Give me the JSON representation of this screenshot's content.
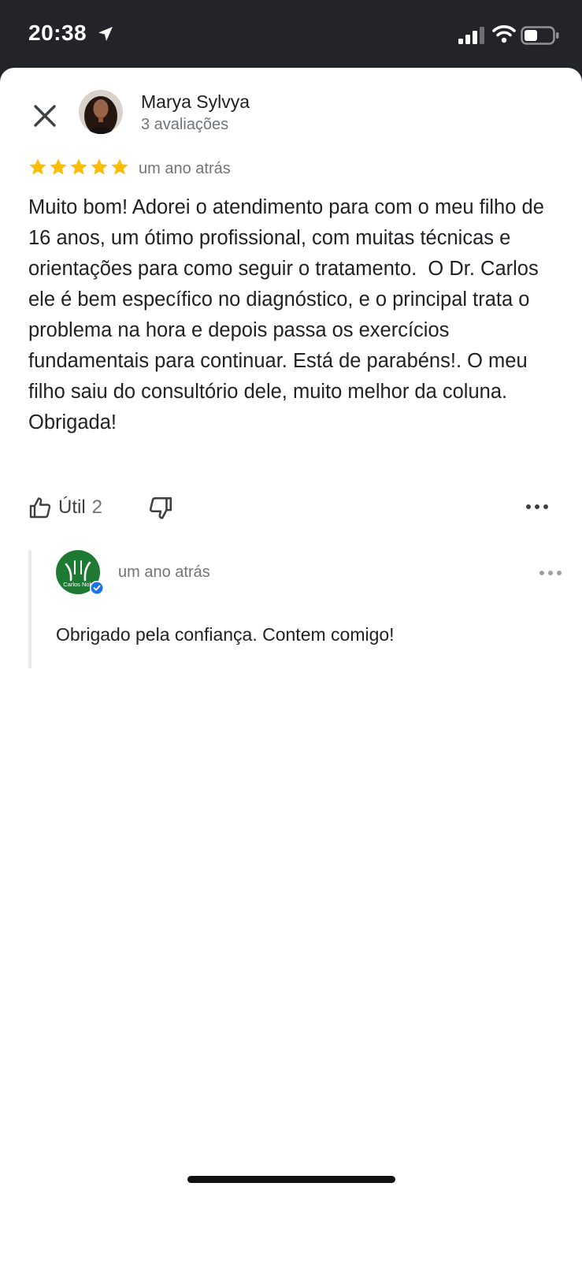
{
  "status_bar": {
    "time": "20:38",
    "icons": [
      "location-arrow-icon",
      "cellular-signal-icon",
      "wifi-icon",
      "battery-icon"
    ]
  },
  "review": {
    "reviewer_name": "Marya Sylvya",
    "reviewer_reviews": "3 avaliações",
    "rating": 5,
    "date": "um ano atrás",
    "text": "Muito bom! Adorei o atendimento para com o meu filho de 16 anos, um ótimo profissional, com muitas técnicas e orientações para como seguir o tratamento.  O Dr. Carlos ele é bem específico no diagnóstico, e o principal trata o problema na hora e depois passa os exercícios fundamentais para continuar. Está de parabéns!. O meu filho saiu do consultório dele, muito melhor da coluna. Obrigada!",
    "helpful_label": "Útil",
    "helpful_count": "2"
  },
  "owner_reply": {
    "logo_text": "Carlos Nob",
    "date": "um ano atrás",
    "text": "Obrigado pela confiança. Contem comigo!"
  },
  "colors": {
    "star": "#fbbc04",
    "logo_green": "#1e7a32",
    "verified_blue": "#1a73e8",
    "secondary_text": "#70757a"
  }
}
